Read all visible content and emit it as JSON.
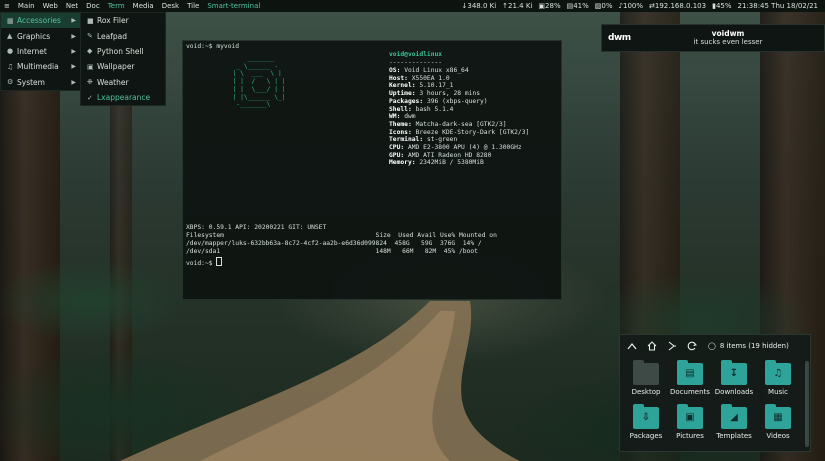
{
  "topbar": {
    "menu_icon": "menu-icon",
    "items": [
      "Main",
      "Web",
      "Net",
      "Doc",
      "Term",
      "Media",
      "Desk",
      "Tile"
    ],
    "window_title": "Smart-terminal",
    "net_down": "348.0 Ki",
    "net_up": "21.4 Ki",
    "cpu": "28%",
    "mem": "41%",
    "swap": "0%",
    "volume": "100%",
    "ip": "192.168.0.103",
    "battery": "45%",
    "clock": "21:38:45 Thu 18/02/21"
  },
  "menu": {
    "categories": [
      {
        "label": "Accessories",
        "icon": "accessories-icon"
      },
      {
        "label": "Graphics",
        "icon": "graphics-icon"
      },
      {
        "label": "Internet",
        "icon": "internet-icon"
      },
      {
        "label": "Multimedia",
        "icon": "multimedia-icon"
      },
      {
        "label": "System",
        "icon": "system-icon"
      }
    ],
    "apps": [
      {
        "label": "Rox Filer",
        "icon": "folder-icon"
      },
      {
        "label": "Leafpad",
        "icon": "text-editor-icon"
      },
      {
        "label": "Python Shell",
        "icon": "python-icon"
      },
      {
        "label": "Wallpaper",
        "icon": "wallpaper-icon"
      },
      {
        "label": "Weather",
        "icon": "weather-icon"
      },
      {
        "label": "Lxappearance",
        "icon": "appearance-icon"
      }
    ]
  },
  "terminal": {
    "prompt1": "void:~$ myvoid",
    "ascii_art": "                _______\n             _ \\______ -\n            | \\  ___  \\ |\n            | |  /   \\ | |\n            | |  \\___/ | |\n            | |\\______ \\_|\n             -_______\\",
    "user_host": "void@voidlinux",
    "separator": "--------------",
    "info": [
      {
        "k": "OS",
        "v": "Void Linux x86_64"
      },
      {
        "k": "Host",
        "v": "X550EA 1.0"
      },
      {
        "k": "Kernel",
        "v": "5.10.17_1"
      },
      {
        "k": "Uptime",
        "v": "3 hours, 28 mins"
      },
      {
        "k": "Packages",
        "v": "396 (xbps-query)"
      },
      {
        "k": "Shell",
        "v": "bash 5.1.4"
      },
      {
        "k": "WM",
        "v": "dwm"
      },
      {
        "k": "Theme",
        "v": "Matcha-dark-sea [GTK2/3]"
      },
      {
        "k": "Icons",
        "v": "Breeze KDE-Story-Dark [GTK2/3]"
      },
      {
        "k": "Terminal",
        "v": "st-green"
      },
      {
        "k": "CPU",
        "v": "AMD E2-3800 APU (4) @ 1.300GHz"
      },
      {
        "k": "GPU",
        "v": "AMD ATI Radeon HD 8280"
      },
      {
        "k": "Memory",
        "v": "2342MiB / 5380MiB"
      }
    ],
    "xbps_line": "XBPS: 0.59.1 API: 20200221 GIT: UNSET",
    "df_header": "Filesystem                                        Size  Used Avail Use% Mounted on",
    "df_rows": [
      "/dev/mapper/luks-632bb63a-8c72-4cf2-aa2b-e6d36d099824  458G   59G  376G  14% /",
      "/dev/sda1                                         148M   66M   82M  45% /boot"
    ],
    "prompt2": "void:~$ "
  },
  "notification": {
    "logo": "dwm",
    "title": "voidwm",
    "body": "it sucks even lesser"
  },
  "filemanager": {
    "status": "8 items (19 hidden)",
    "items": [
      {
        "label": "Desktop",
        "icon": "desktop-folder-icon"
      },
      {
        "label": "Documents",
        "icon": "documents-folder-icon"
      },
      {
        "label": "Downloads",
        "icon": "downloads-folder-icon"
      },
      {
        "label": "Music",
        "icon": "music-folder-icon"
      },
      {
        "label": "Packages",
        "icon": "packages-folder-icon"
      },
      {
        "label": "Pictures",
        "icon": "pictures-folder-icon"
      },
      {
        "label": "Templates",
        "icon": "templates-folder-icon"
      },
      {
        "label": "Videos",
        "icon": "videos-folder-icon"
      }
    ]
  }
}
